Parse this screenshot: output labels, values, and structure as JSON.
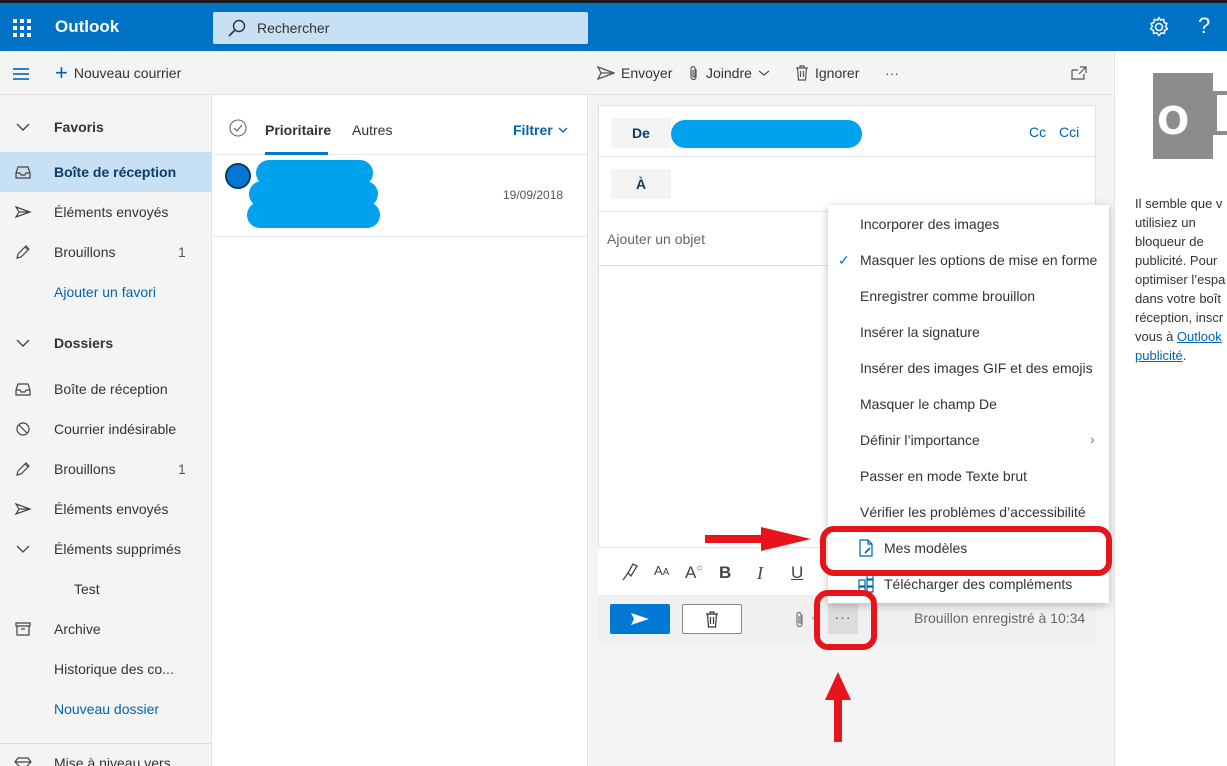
{
  "header": {
    "app_title": "Outlook",
    "search_placeholder": "Rechercher",
    "settings_icon": "gear-icon",
    "help_label": "?"
  },
  "commandbar": {
    "new_mail": "Nouveau courrier",
    "send": "Envoyer",
    "attach": "Joindre",
    "discard": "Ignorer",
    "more": "···"
  },
  "nav": {
    "favorites_header": "Favoris",
    "favorites": [
      {
        "label": "Boîte de réception",
        "count": ""
      },
      {
        "label": "Éléments envoyés",
        "count": ""
      },
      {
        "label": "Brouillons",
        "count": "1"
      }
    ],
    "add_favorite": "Ajouter un favori",
    "folders_header": "Dossiers",
    "folders": [
      {
        "label": "Boîte de réception",
        "count": ""
      },
      {
        "label": "Courrier indésirable",
        "count": ""
      },
      {
        "label": "Brouillons",
        "count": "1"
      },
      {
        "label": "Éléments envoyés",
        "count": ""
      },
      {
        "label": "Éléments supprimés",
        "count": ""
      },
      {
        "label": "Test",
        "count": ""
      },
      {
        "label": "Archive",
        "count": ""
      },
      {
        "label": "Historique des co...",
        "count": ""
      }
    ],
    "new_folder": "Nouveau dossier",
    "upgrade": "Mise à niveau vers"
  },
  "messagelist": {
    "tab_focused": "Prioritaire",
    "tab_other": "Autres",
    "filter": "Filtrer",
    "messages": [
      {
        "date": "19/09/2018"
      }
    ]
  },
  "compose": {
    "from_label": "De",
    "to_label": "À",
    "cc_label": "Cc",
    "bcc_label": "Cci",
    "subject_placeholder": "Ajouter un objet",
    "saved_status": "Brouillon enregistré à 10:34",
    "more_label": "···"
  },
  "menu": {
    "items": [
      {
        "label": "Incorporer des images"
      },
      {
        "label": "Masquer les options de mise en forme",
        "checked": "✓"
      },
      {
        "label": "Enregistrer comme brouillon"
      },
      {
        "label": "Insérer la signature"
      },
      {
        "label": "Insérer des images GIF et des emojis"
      },
      {
        "label": "Masquer le champ De"
      },
      {
        "label": "Définir l’importance",
        "submenu": "›"
      },
      {
        "label": "Passer en mode Texte brut"
      },
      {
        "label": "Vérifier les problèmes d’accessibilité"
      },
      {
        "label": "Mes modèles"
      },
      {
        "label": "Télécharger des compléments"
      }
    ]
  },
  "adpanel": {
    "text": "Il semble que v\nutilisiez un\nbloqueur de\npublicité. Pour\noptimiser l’espa\ndans votre boît\nréception, inscr\nvous à ",
    "link1": "Outlook",
    "link2": "publicité",
    "period": "."
  },
  "colors": {
    "brand": "#0072c6",
    "accent": "#0078d4",
    "annotation_red": "#e8141b",
    "redacted_blue": "#00a2ed"
  }
}
